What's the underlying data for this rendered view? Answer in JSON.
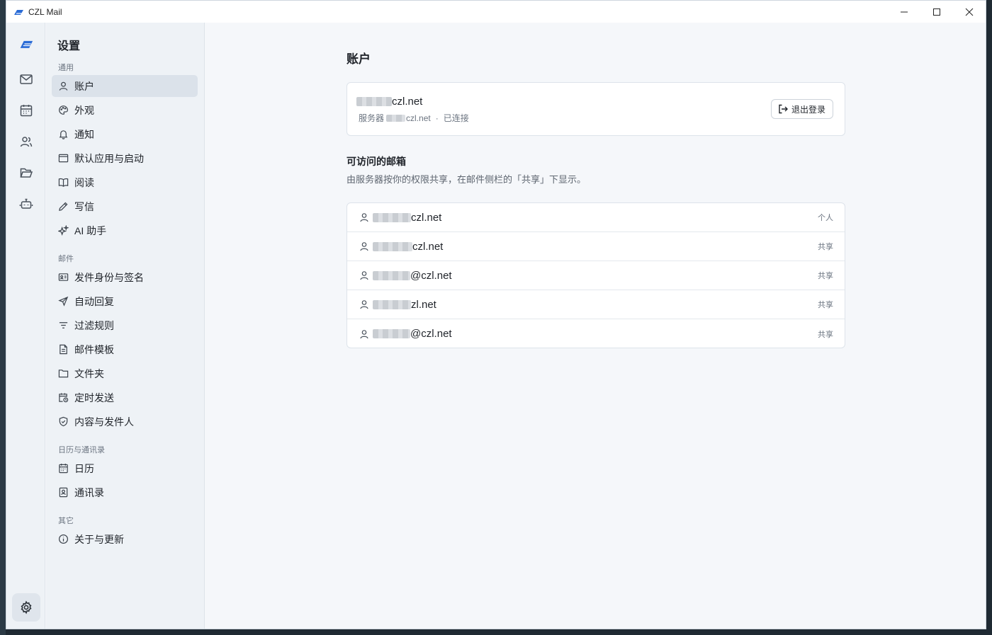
{
  "window": {
    "title": "CZL Mail"
  },
  "rail": {
    "items": [
      "mail-icon",
      "calendar-icon",
      "contacts-icon",
      "folder-icon",
      "bot-icon"
    ],
    "settings_icon": "gear-icon"
  },
  "nav": {
    "title": "设置",
    "sections": [
      {
        "label": "通用",
        "items": [
          {
            "label": "账户",
            "icon": "user-icon",
            "active": true
          },
          {
            "label": "外观",
            "icon": "palette-icon"
          },
          {
            "label": "通知",
            "icon": "bell-icon"
          },
          {
            "label": "默认应用与启动",
            "icon": "window-icon"
          },
          {
            "label": "阅读",
            "icon": "book-icon"
          },
          {
            "label": "写信",
            "icon": "pen-icon"
          },
          {
            "label": "AI 助手",
            "icon": "sparkles-icon"
          }
        ]
      },
      {
        "label": "邮件",
        "items": [
          {
            "label": "发件身份与签名",
            "icon": "id-card-icon"
          },
          {
            "label": "自动回复",
            "icon": "plane-icon"
          },
          {
            "label": "过滤规则",
            "icon": "filter-icon"
          },
          {
            "label": "邮件模板",
            "icon": "document-icon"
          },
          {
            "label": "文件夹",
            "icon": "folder-icon"
          },
          {
            "label": "定时发送",
            "icon": "calendar-clock-icon"
          },
          {
            "label": "内容与发件人",
            "icon": "shield-icon"
          }
        ]
      },
      {
        "label": "日历与通讯录",
        "items": [
          {
            "label": "日历",
            "icon": "calendar-icon"
          },
          {
            "label": "通讯录",
            "icon": "contact-book-icon"
          }
        ]
      },
      {
        "label": "其它",
        "items": [
          {
            "label": "关于与更新",
            "icon": "info-icon"
          }
        ]
      }
    ]
  },
  "main": {
    "title": "账户",
    "account": {
      "email_suffix": "czl.net",
      "server_prefix": "服务器",
      "server_suffix": "czl.net",
      "status": "已连接",
      "logout_label": "退出登录"
    },
    "mailboxes": {
      "title": "可访问的邮箱",
      "description": "由服务器按你的权限共享，在邮件侧栏的「共享」下显示。",
      "items": [
        {
          "address_suffix": "czl.net",
          "tag": "个人"
        },
        {
          "address_suffix": "czl.net",
          "tag": "共享"
        },
        {
          "address_suffix": "@czl.net",
          "tag": "共享"
        },
        {
          "address_suffix": "zl.net",
          "tag": "共享"
        },
        {
          "address_suffix": "@czl.net",
          "tag": "共享"
        }
      ]
    }
  }
}
